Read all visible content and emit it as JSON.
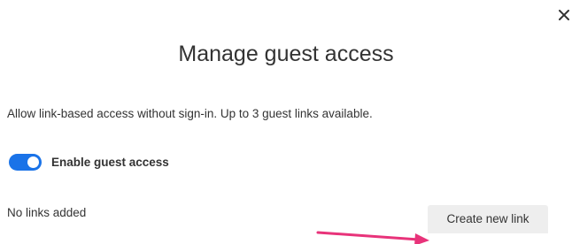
{
  "dialog": {
    "title": "Manage guest access",
    "description": "Allow link-based access without sign-in. Up to 3 guest links available.",
    "close_icon": "close-icon"
  },
  "guest_access": {
    "toggle_label": "Enable guest access",
    "enabled": true
  },
  "links": {
    "empty_text": "No links added",
    "create_button_label": "Create new link"
  },
  "annotation": {
    "arrow_color": "#e8337a"
  },
  "colors": {
    "toggle_on": "#1a73e8",
    "button_bg": "#eeeeee"
  }
}
